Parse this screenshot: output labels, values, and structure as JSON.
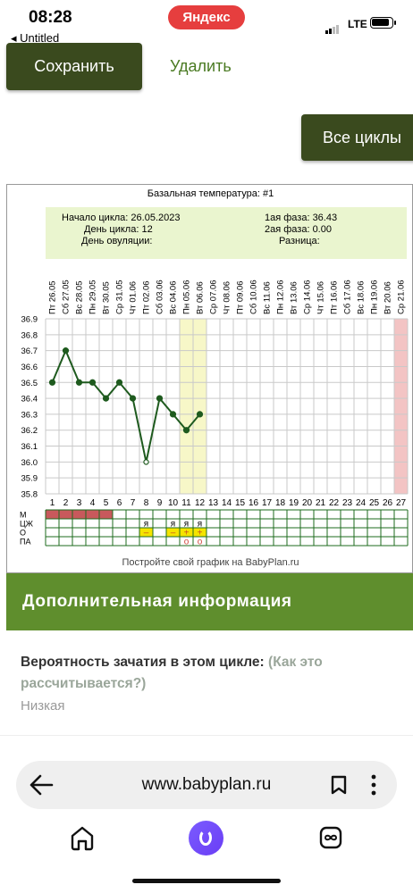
{
  "status": {
    "time": "08:28",
    "back_app": "◂ Untitled",
    "center_pill": "Яндекс",
    "network": "LTE"
  },
  "toolbar": {
    "save_label": "Сохранить",
    "delete_label": "Удалить",
    "all_cycles_label": "Все циклы"
  },
  "chart_info": {
    "title": "Базальная температура: #1",
    "cycle_start": "Начало цикла: 26.05.2023",
    "cycle_day": "День цикла: 12",
    "ovulation_day": "День овуляции:",
    "phase1": "1ая фаза: 36.43",
    "phase2": "2ая фаза: 0.00",
    "difference": "Разница:",
    "footer": "Постройте свой график на BabyPlan.ru"
  },
  "chart_data": {
    "type": "line",
    "dates": [
      "Пт 26.05",
      "Сб 27.05",
      "Вс 28.05",
      "Пн 29.05",
      "Вт 30.05",
      "Ср 31.05",
      "Чт 01.06",
      "Пт 02.06",
      "Сб 03.06",
      "Вс 04.06",
      "Пн 05.06",
      "Вт 06.06",
      "Ср 07.06",
      "Чт 08.06",
      "Пт 09.06",
      "Сб 10.06",
      "Вс 11.06",
      "Пн 12.06",
      "Вт 13.06",
      "Ср 14.06",
      "Чт 15.06",
      "Пт 16.06",
      "Сб 17.06",
      "Вс 18.06",
      "Пн 19.06",
      "Вт 20.06",
      "Ср 21.06"
    ],
    "days": [
      1,
      2,
      3,
      4,
      5,
      6,
      7,
      8,
      9,
      10,
      11,
      12,
      13,
      14,
      15,
      16,
      17,
      18,
      19,
      20,
      21,
      22,
      23,
      24,
      25,
      26,
      27
    ],
    "y_ticks": [
      "36.9",
      "36.8",
      "36.7",
      "36.6",
      "36.5",
      "36.4",
      "36.3",
      "36.2",
      "36.1",
      "36.0",
      "35.9",
      "35.8"
    ],
    "ylim": [
      35.8,
      36.9
    ],
    "temperatures": [
      36.5,
      36.7,
      36.5,
      36.5,
      36.4,
      36.5,
      36.4,
      36.0,
      36.4,
      36.3,
      36.2,
      36.3
    ],
    "open_marker_day": 8,
    "highlight_days": [
      11,
      12
    ],
    "highlight_color": "#f7f7c8",
    "end_day_color": "#f3c4c4",
    "line_color": "#1e5a1e",
    "row_labels": [
      "М",
      "ЦЖ",
      "О",
      "ПА"
    ],
    "menstruation_days": [
      1,
      2,
      3,
      4,
      5
    ],
    "menstruation_color": "#c8595c",
    "cm_marks": [
      {
        "day": 8,
        "text": "я"
      },
      {
        "day": 10,
        "text": "я"
      },
      {
        "day": 11,
        "text": "я"
      },
      {
        "day": 12,
        "text": "я"
      }
    ],
    "o_marks": [
      {
        "day": 8,
        "text": "–"
      },
      {
        "day": 10,
        "text": "–"
      },
      {
        "day": 11,
        "text": "+"
      },
      {
        "day": 12,
        "text": "+"
      }
    ],
    "pa_marks": [
      {
        "day": 11,
        "text": "o"
      },
      {
        "day": 12,
        "text": "o"
      }
    ],
    "o_mark_color": "#f5e400"
  },
  "section": {
    "title": "Дополнительная информация",
    "prob_label": "Вероятность зачатия в этом цикле:",
    "prob_link": "(Как это рассчитывается?)",
    "prob_value": "Низкая"
  },
  "browser": {
    "url": "www.babyplan.ru"
  },
  "icons": [
    "back-arrow-icon",
    "bookmark-icon",
    "more-icon",
    "home-icon",
    "alice-icon",
    "tabs-icon"
  ]
}
